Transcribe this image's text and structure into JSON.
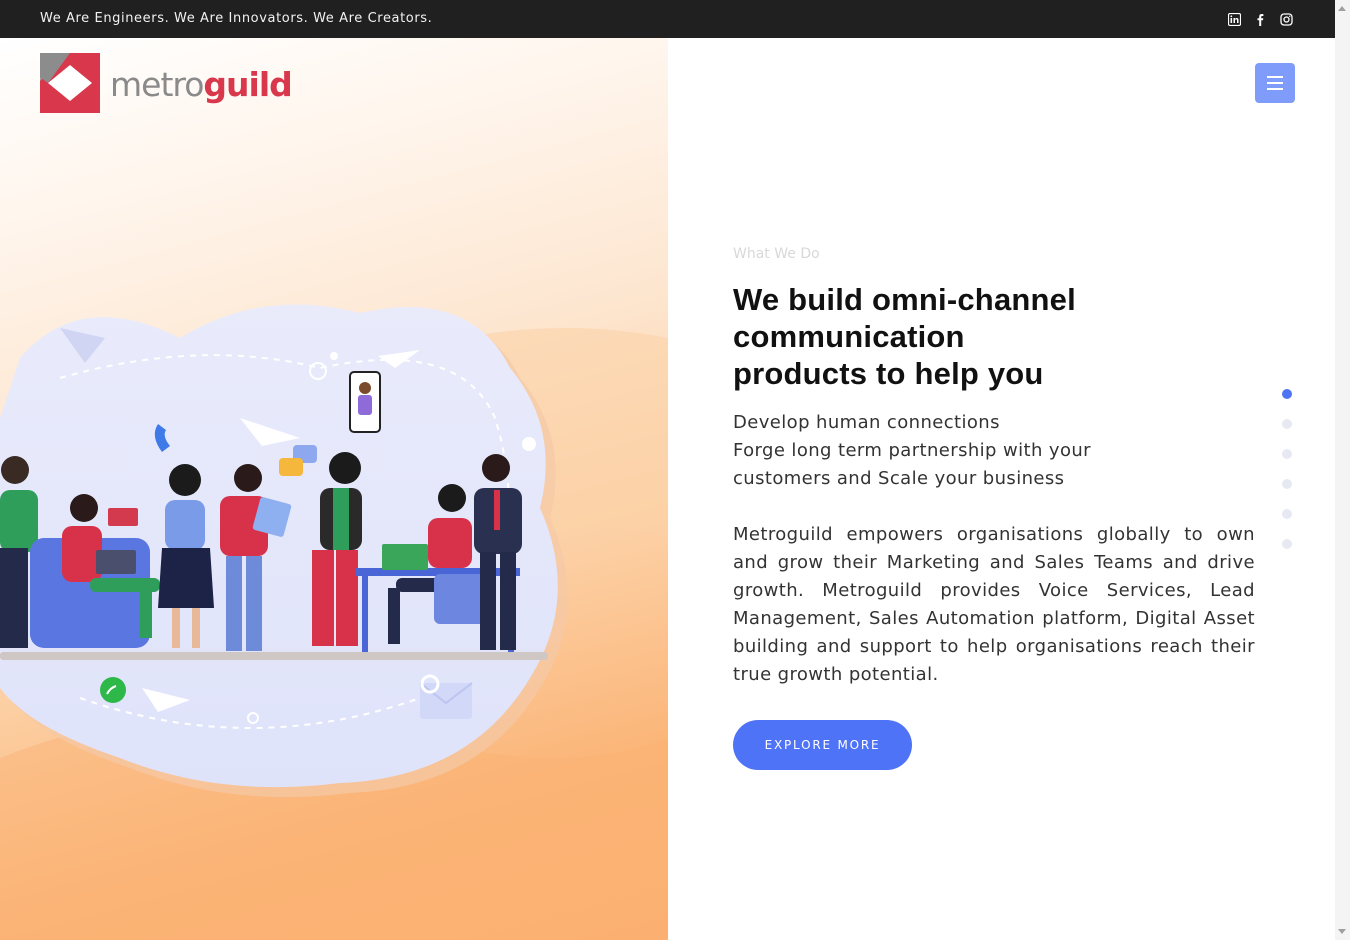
{
  "topbar": {
    "tagline": "We Are Engineers. We Are Innovators. We Are Creators.",
    "social_icons": [
      "linkedin-icon",
      "facebook-icon",
      "instagram-icon"
    ]
  },
  "logo": {
    "part1": "metro",
    "part2": "guild"
  },
  "menu": {
    "icon": "hamburger-icon"
  },
  "hero": {
    "eyebrow": "What We Do",
    "headline": {
      "line1": "We build omni-channel",
      "line2_bold": "communication",
      "line3_bold": "products",
      "line3_rest": " to help you"
    },
    "lead": [
      "Develop human connections",
      "Forge long term partnership with your",
      "customers and Scale your business"
    ],
    "body": "Metroguild empowers organisations globally to own and grow their Marketing and Sales Teams and drive growth. Metroguild provides Voice Services, Lead Management, Sales Automation platform, Digital Asset building and support to help organisations reach their true growth potential.",
    "cta": "EXPLORE MORE"
  },
  "pager": {
    "count": 6,
    "active": 0
  },
  "colors": {
    "accent": "#4f73f6",
    "brand_red": "#d9374b",
    "topbar_bg": "#202020",
    "menu_bg": "#7f9cfb"
  }
}
